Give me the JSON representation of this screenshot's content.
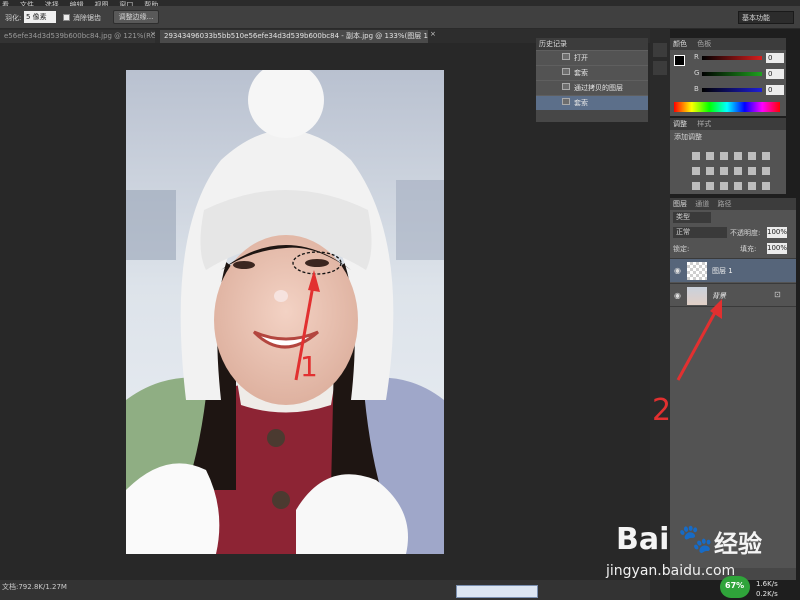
{
  "menubar": {
    "items": [
      "看",
      "文件",
      "选择",
      "编辑",
      "视图",
      "窗口",
      "帮助"
    ]
  },
  "options": {
    "feather_label": "羽化:",
    "feather_value": "5 像素",
    "antialias_label": "消除锯齿",
    "refine_edge_label": "调整边缘...",
    "workspace": "基本功能"
  },
  "tabs": [
    "e56efe34d3d539b600bc84.jpg @ 121%(RGB/8#) *",
    "29343496033b5bb510e56efe34d3d539b600bc84 - 副本.jpg @ 133%(图层 1, RGB/8#) *"
  ],
  "history": {
    "title": "历史记录",
    "items": [
      "打开",
      "套索",
      "通过拷贝的图层",
      "套索"
    ]
  },
  "color_panel": {
    "tabs": [
      "颜色",
      "色板"
    ],
    "channels": [
      {
        "label": "R",
        "value": "0",
        "color": "#d81e1e"
      },
      {
        "label": "G",
        "value": "0",
        "color": "#1ea11e"
      },
      {
        "label": "B",
        "value": "0",
        "color": "#1e1ed8"
      }
    ]
  },
  "adjustments": {
    "tabs": [
      "调整",
      "样式"
    ],
    "title": "添加调整"
  },
  "layers": {
    "tabs": [
      "图层",
      "通道",
      "路径"
    ],
    "kind_filter": "类型",
    "blend_mode": "正常",
    "opacity_label": "不透明度:",
    "opacity_value": "100%",
    "lock_label": "锁定:",
    "fill_label": "填充:",
    "fill_value": "100%",
    "items": [
      {
        "name": "图层 1",
        "selected": true
      },
      {
        "name": "背景",
        "selected": false
      }
    ]
  },
  "status": {
    "doc_size": "文档:792.8K/1.27M"
  },
  "annotations": {
    "label1": "1",
    "label2": "2",
    "color": "#e23030"
  },
  "watermark": {
    "site": "jingyan.baidu.com",
    "logo_text": "Bai",
    "logo_text2": "经验"
  },
  "tray": {
    "percent": "67%",
    "up_speed": "1.6K/s",
    "down_speed": "0.2K/s"
  }
}
